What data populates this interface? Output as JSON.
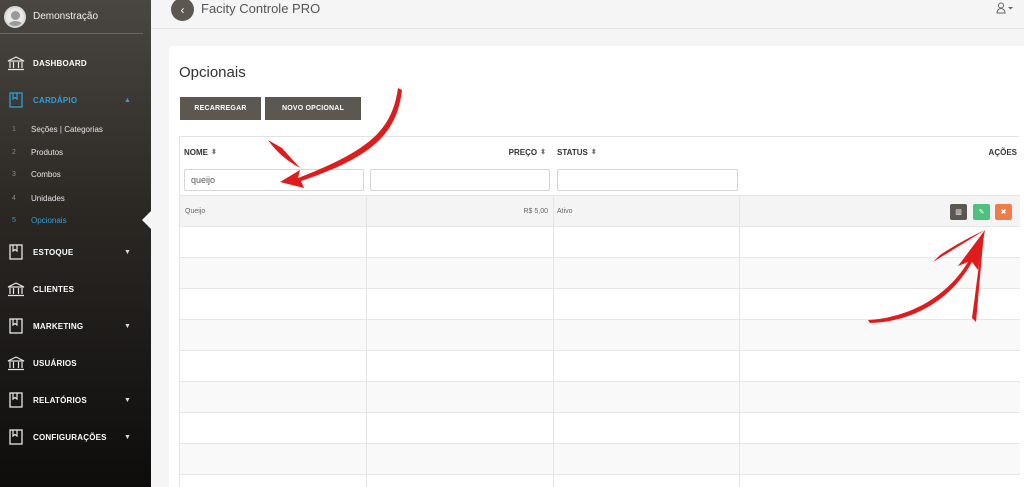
{
  "profile": {
    "name": "Demonstração"
  },
  "menu": {
    "dashboard": "DASHBOARD",
    "cardapio": "CARDÁPIO",
    "sub": [
      {
        "num": "1",
        "label": "Seções | Categorias"
      },
      {
        "num": "2",
        "label": "Produtos"
      },
      {
        "num": "3",
        "label": "Combos"
      },
      {
        "num": "4",
        "label": "Unidades"
      },
      {
        "num": "5",
        "label": "Opcionais"
      }
    ],
    "estoque": "ESTOQUE",
    "clientes": "CLIENTES",
    "marketing": "MARKETING",
    "usuarios": "USUÁRIOS",
    "relatorios": "RELATÓRIOS",
    "configuracoes": "CONFIGURAÇÕES"
  },
  "topbar": {
    "app_title": "Facity Controle PRO"
  },
  "page": {
    "title": "Opcionais",
    "reload_label": "RECARREGAR",
    "new_label": "NOVO OPCIONAL"
  },
  "table": {
    "headers": {
      "nome": "NOME",
      "preco": "PREÇO",
      "status": "STATUS",
      "acoes": "AÇÕES"
    },
    "filter_nome_value": "queijo",
    "rows": [
      {
        "nome": "Queijo",
        "preco": "R$ 5,00",
        "status": "Ativo"
      }
    ]
  },
  "colors": {
    "accent": "#2f9fd6",
    "button": "#5c5751",
    "edit": "#4fc07d",
    "delete": "#ef7d4a",
    "annotation": "#e01b1b"
  }
}
